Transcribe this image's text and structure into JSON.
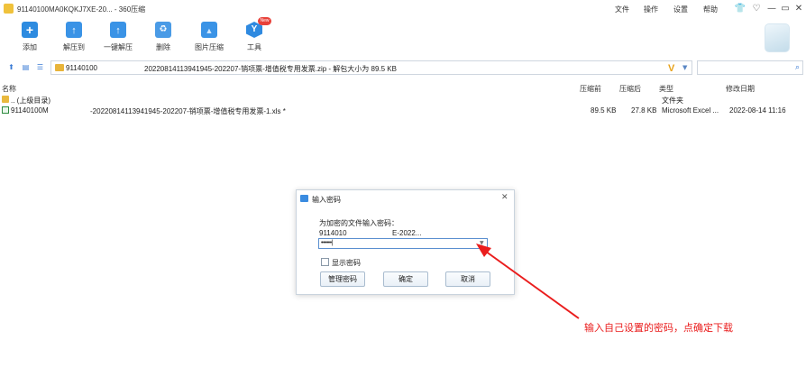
{
  "window": {
    "title": "91140100MA0KQKJ7XE-20... - 360压缩",
    "menu": [
      "文件",
      "操作",
      "设置",
      "帮助"
    ],
    "controls": [
      "👕",
      "♡",
      "—",
      "▭",
      "✕"
    ]
  },
  "toolbar": {
    "items": [
      {
        "label": "添加",
        "icon": "add-icon"
      },
      {
        "label": "解压到",
        "icon": "extract-to-icon"
      },
      {
        "label": "一键解压",
        "icon": "one-click-extract-icon"
      },
      {
        "label": "删除",
        "icon": "delete-icon"
      },
      {
        "label": "图片压缩",
        "icon": "image-compress-icon"
      },
      {
        "label": "工具",
        "icon": "tools-icon"
      }
    ],
    "badge": "New"
  },
  "address": {
    "part1": "91140100",
    "part2": "20220814113941945-202207-销项票-增值税专用发票.zip - 解包大小为 89.5 KB",
    "v_label": "V",
    "dropdown": "▼",
    "search_icon": "⌕",
    "nav_icons": [
      "⬆",
      "▤",
      "☰"
    ]
  },
  "table": {
    "columns": [
      "名称",
      "压缩前",
      "压缩后",
      "类型",
      "修改日期"
    ],
    "rows": [
      {
        "name": ".. (上级目录)",
        "before": "",
        "after": "",
        "type": "文件夹",
        "date": ""
      },
      {
        "name_a": "91140100M",
        "name_b": "-20220814113941945-202207-销项票-增值税专用发票-1.xls *",
        "before": "89.5 KB",
        "after": "27.8 KB",
        "type": "Microsoft Excel ...",
        "date": "2022-08-14 11:16"
      }
    ]
  },
  "dialog": {
    "title": "输入密码",
    "close": "✕",
    "prompt": "为加密的文件输入密码：",
    "file_a": "9114010",
    "file_b": "E-2022...",
    "password": "••••••|",
    "show_password": "显示密码",
    "buttons": [
      "管理密码",
      "确定",
      "取消"
    ]
  },
  "annotation": "输入自己设置的密码，点确定下载",
  "colors": {
    "accent": "#2d8be0",
    "annotation": "#ea1d1d"
  }
}
